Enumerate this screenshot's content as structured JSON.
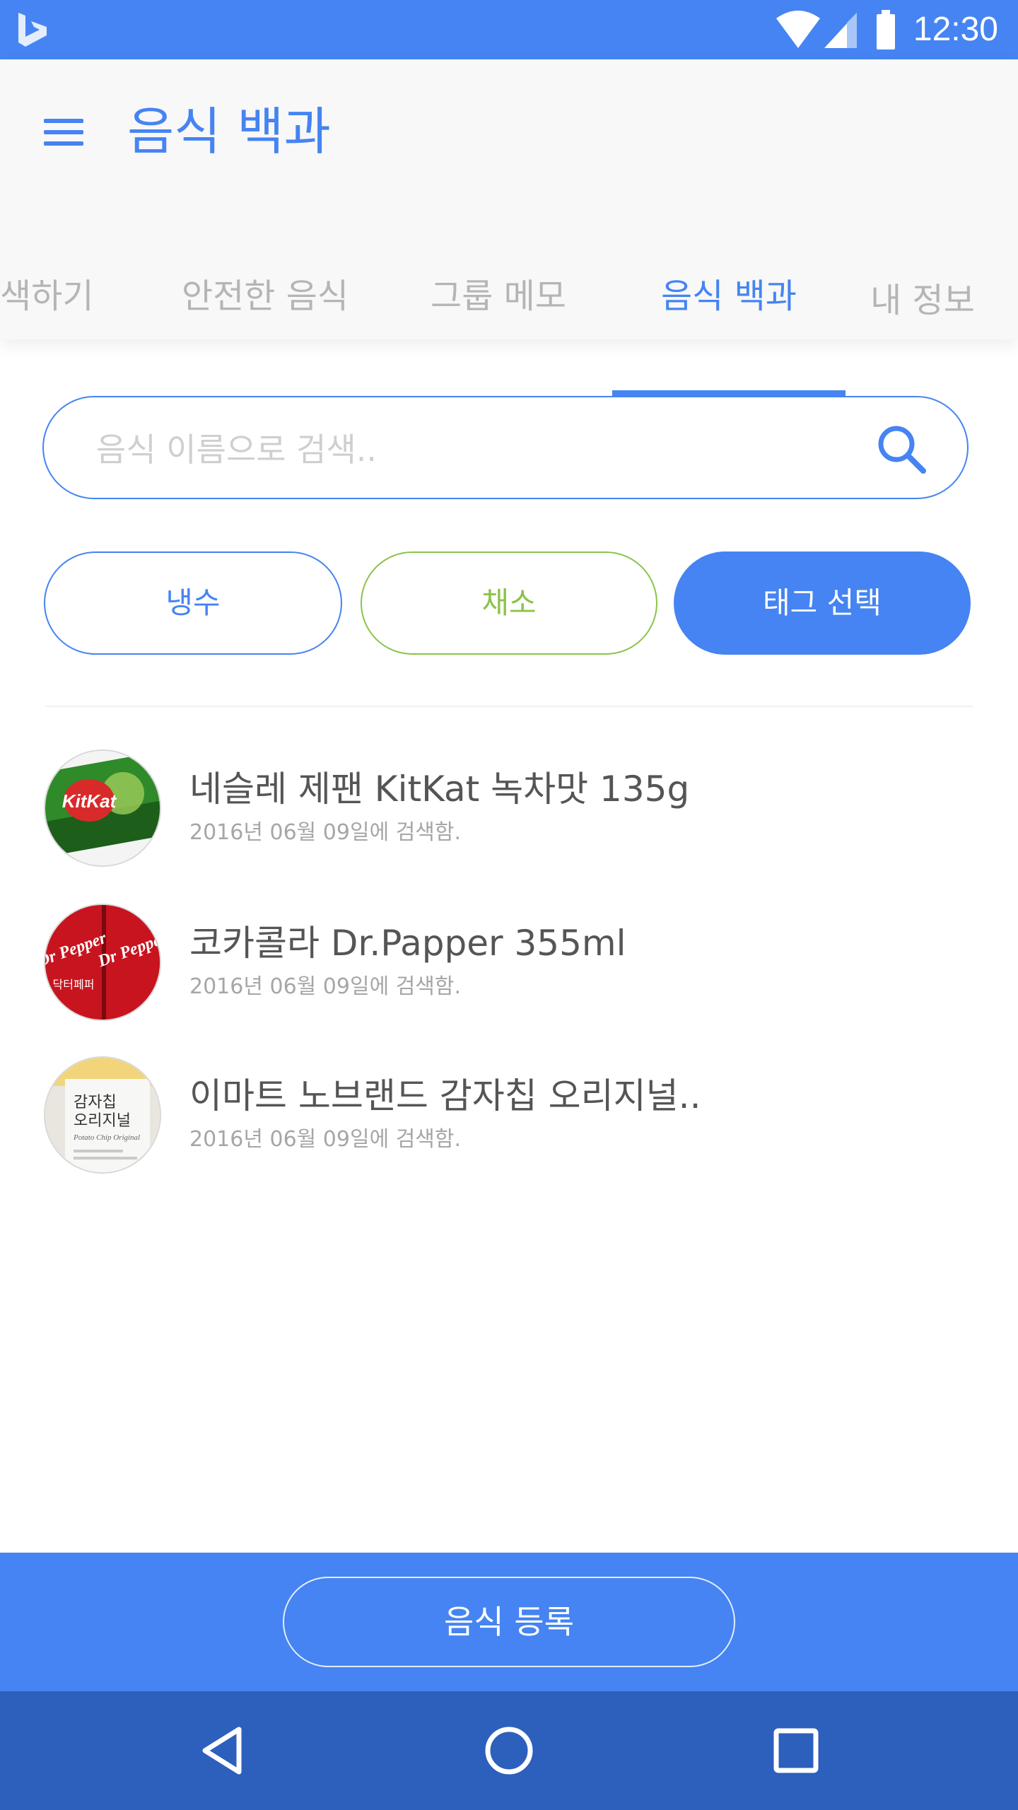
{
  "status_bar": {
    "time": "12:30",
    "icons": [
      "bing-logo-icon",
      "wifi-icon",
      "cell-signal-icon",
      "battery-icon"
    ]
  },
  "app_bar": {
    "title": "음식 백과",
    "menu_icon": "hamburger-menu-icon"
  },
  "tabs": [
    {
      "label": "색하기",
      "active": false
    },
    {
      "label": "안전한 음식",
      "active": false
    },
    {
      "label": "그룹 메모",
      "active": false
    },
    {
      "label": "음식 백과",
      "active": true
    },
    {
      "label": "내 정보",
      "active": false
    }
  ],
  "search": {
    "placeholder": "음식 이름으로 검색..",
    "value": "",
    "icon": "search-icon"
  },
  "tags": {
    "water": "냉수",
    "vegetable": "채소",
    "select": "태그 선택"
  },
  "foods": [
    {
      "title": "네슬레 제팬 KitKat 녹차맛 135g",
      "date": "2016년 06월 09일에 검색함.",
      "thumb_logo": "KitKat"
    },
    {
      "title": "코카콜라 Dr.Papper 355ml",
      "date": "2016년 06월 09일에 검색함.",
      "thumb_logo": "Dr Pepper",
      "thumb_sub": "닥터페퍼"
    },
    {
      "title": "이마트 노브랜드 감자칩 오리지널..",
      "date": "2016년 06월 09일에 검색함.",
      "thumb_line1": "감자칩",
      "thumb_line2": "오리지널",
      "thumb_sub": "Potato Chip Original"
    }
  ],
  "bottom": {
    "register_label": "음식 등록"
  },
  "colors": {
    "primary": "#4584f2",
    "nav_bar": "#2d5fbd",
    "tag_vegetable": "#8bc34a",
    "inactive_tab": "#b5b5b5"
  }
}
